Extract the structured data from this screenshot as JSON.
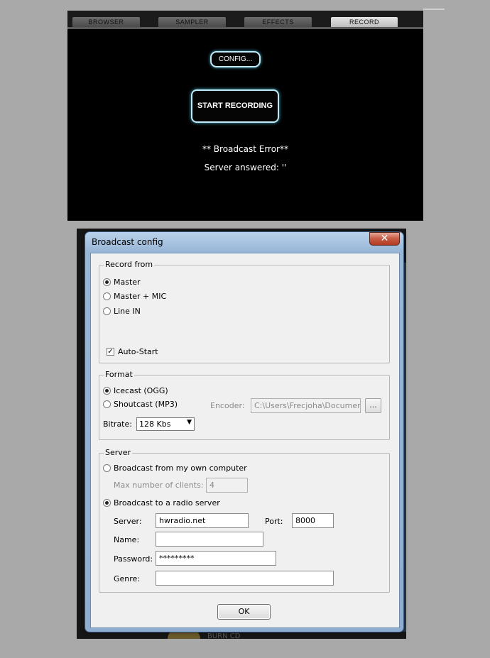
{
  "app": {
    "tabs": [
      {
        "label": "BROWSER",
        "active": false
      },
      {
        "label": "SAMPLER",
        "active": false
      },
      {
        "label": "EFFECTS",
        "active": false
      },
      {
        "label": "RECORD",
        "active": true
      }
    ],
    "config_label": "CONFIG...",
    "start_label": "START RECORDING",
    "error_line1": "** Broadcast Error**",
    "error_line2": "Server answered: ''",
    "bg_text": "BURN CD"
  },
  "dialog": {
    "title": "Broadcast config",
    "close_glyph": "✕",
    "record_from": {
      "label": "Record from",
      "options": [
        "Master",
        "Master + MIC",
        "Line IN"
      ],
      "selected": "Master",
      "auto_start_label": "Auto-Start",
      "auto_start_checked": true
    },
    "format": {
      "label": "Format",
      "options": [
        "Icecast (OGG)",
        "Shoutcast (MP3)"
      ],
      "selected": "Icecast (OGG)",
      "encoder_label": "Encoder:",
      "encoder_value": "C:\\Users\\Frecjoha\\Documents\\",
      "browse_label": "...",
      "bitrate_label": "Bitrate:",
      "bitrate_value": "128 Kbs"
    },
    "server": {
      "label": "Server",
      "own_computer_label": "Broadcast from my own computer",
      "max_clients_label": "Max number of clients:",
      "max_clients_value": "4",
      "radio_server_label": "Broadcast to a radio server",
      "selected": "Broadcast to a radio server",
      "server_label": "Server:",
      "server_value": "hwradio.net",
      "port_label": "Port:",
      "port_value": "8000",
      "name_label": "Name:",
      "name_value": "",
      "password_label": "Password:",
      "password_value": "*********",
      "genre_label": "Genre:",
      "genre_value": ""
    },
    "ok_label": "OK"
  }
}
